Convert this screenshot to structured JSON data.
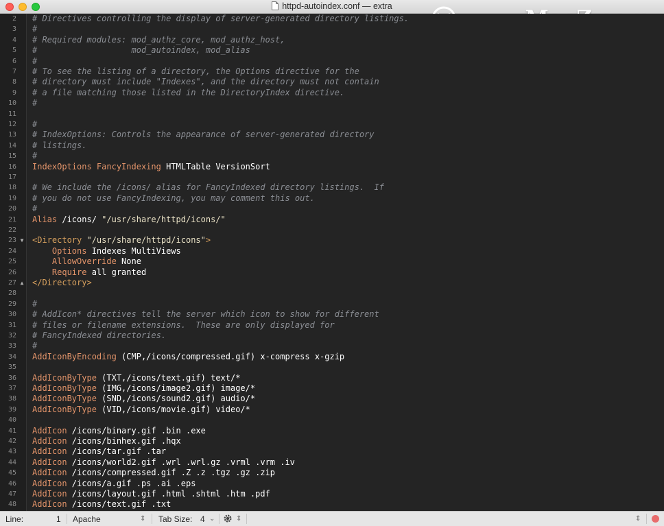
{
  "window": {
    "title": "httpd-autoindex.conf — extra"
  },
  "watermark": {
    "text": "www.MacZ.com"
  },
  "colors": {
    "comment": "#8a8d93",
    "keyword": "#e3946a",
    "text": "#ffffff",
    "string": "#e9e1c5",
    "tag": "#d8a15e",
    "background": "#242424"
  },
  "lines": [
    {
      "n": "2",
      "segs": [
        {
          "t": "# Directives controlling the display of server-generated directory listings.",
          "c": "cm"
        }
      ]
    },
    {
      "n": "3",
      "segs": [
        {
          "t": "#",
          "c": "cm"
        }
      ]
    },
    {
      "n": "4",
      "segs": [
        {
          "t": "# Required modules: mod_authz_core, mod_authz_host,",
          "c": "cm"
        }
      ]
    },
    {
      "n": "5",
      "segs": [
        {
          "t": "#                   mod_autoindex, mod_alias",
          "c": "cm"
        }
      ]
    },
    {
      "n": "6",
      "segs": [
        {
          "t": "#",
          "c": "cm"
        }
      ]
    },
    {
      "n": "7",
      "segs": [
        {
          "t": "# To see the listing of a directory, the Options directive for the",
          "c": "cm"
        }
      ]
    },
    {
      "n": "8",
      "segs": [
        {
          "t": "# directory must include \"Indexes\", and the directory must not contain",
          "c": "cm"
        }
      ]
    },
    {
      "n": "9",
      "segs": [
        {
          "t": "# a file matching those listed in the DirectoryIndex directive.",
          "c": "cm"
        }
      ]
    },
    {
      "n": "10",
      "segs": [
        {
          "t": "#",
          "c": "cm"
        }
      ]
    },
    {
      "n": "11",
      "segs": []
    },
    {
      "n": "12",
      "segs": [
        {
          "t": "#",
          "c": "cm"
        }
      ]
    },
    {
      "n": "13",
      "segs": [
        {
          "t": "# IndexOptions: Controls the appearance of server-generated directory",
          "c": "cm"
        }
      ]
    },
    {
      "n": "14",
      "segs": [
        {
          "t": "# listings.",
          "c": "cm"
        }
      ]
    },
    {
      "n": "15",
      "segs": [
        {
          "t": "#",
          "c": "cm"
        }
      ]
    },
    {
      "n": "16",
      "segs": [
        {
          "t": "IndexOptions FancyIndexing",
          "c": "kw"
        },
        {
          "t": " HTMLTable VersionSort",
          "c": "tx"
        }
      ]
    },
    {
      "n": "17",
      "segs": []
    },
    {
      "n": "18",
      "segs": [
        {
          "t": "# We include the /icons/ alias for FancyIndexed directory listings.  If",
          "c": "cm"
        }
      ]
    },
    {
      "n": "19",
      "segs": [
        {
          "t": "# you do not use FancyIndexing, you may comment this out.",
          "c": "cm"
        }
      ]
    },
    {
      "n": "20",
      "segs": [
        {
          "t": "#",
          "c": "cm"
        }
      ]
    },
    {
      "n": "21",
      "segs": [
        {
          "t": "Alias",
          "c": "kw"
        },
        {
          "t": " /icons/ ",
          "c": "tx"
        },
        {
          "t": "\"/usr/share/httpd/icons/\"",
          "c": "st"
        }
      ]
    },
    {
      "n": "22",
      "segs": []
    },
    {
      "n": "23",
      "fold": "▼",
      "segs": [
        {
          "t": "<Directory ",
          "c": "tg"
        },
        {
          "t": "\"/usr/share/httpd/icons\"",
          "c": "st"
        },
        {
          "t": ">",
          "c": "tg"
        }
      ]
    },
    {
      "n": "24",
      "segs": [
        {
          "t": "    ",
          "c": "tx"
        },
        {
          "t": "Options",
          "c": "kw"
        },
        {
          "t": " Indexes MultiViews",
          "c": "tx"
        }
      ]
    },
    {
      "n": "25",
      "segs": [
        {
          "t": "    ",
          "c": "tx"
        },
        {
          "t": "AllowOverride",
          "c": "kw"
        },
        {
          "t": " None",
          "c": "tx"
        }
      ]
    },
    {
      "n": "26",
      "segs": [
        {
          "t": "    ",
          "c": "tx"
        },
        {
          "t": "Require",
          "c": "kw"
        },
        {
          "t": " all granted",
          "c": "tx"
        }
      ]
    },
    {
      "n": "27",
      "fold": "▲",
      "segs": [
        {
          "t": "</Directory>",
          "c": "tg"
        }
      ]
    },
    {
      "n": "28",
      "segs": []
    },
    {
      "n": "29",
      "segs": [
        {
          "t": "#",
          "c": "cm"
        }
      ]
    },
    {
      "n": "30",
      "segs": [
        {
          "t": "# AddIcon* directives tell the server which icon to show for different",
          "c": "cm"
        }
      ]
    },
    {
      "n": "31",
      "segs": [
        {
          "t": "# files or filename extensions.  These are only displayed for",
          "c": "cm"
        }
      ]
    },
    {
      "n": "32",
      "segs": [
        {
          "t": "# FancyIndexed directories.",
          "c": "cm"
        }
      ]
    },
    {
      "n": "33",
      "segs": [
        {
          "t": "#",
          "c": "cm"
        }
      ]
    },
    {
      "n": "34",
      "segs": [
        {
          "t": "AddIconByEncoding",
          "c": "kw"
        },
        {
          "t": " (CMP,/icons/compressed.gif) x-compress x-gzip",
          "c": "tx"
        }
      ]
    },
    {
      "n": "35",
      "segs": []
    },
    {
      "n": "36",
      "segs": [
        {
          "t": "AddIconByType",
          "c": "kw"
        },
        {
          "t": " (TXT,/icons/text.gif) text/*",
          "c": "tx"
        }
      ]
    },
    {
      "n": "37",
      "segs": [
        {
          "t": "AddIconByType",
          "c": "kw"
        },
        {
          "t": " (IMG,/icons/image2.gif) image/*",
          "c": "tx"
        }
      ]
    },
    {
      "n": "38",
      "segs": [
        {
          "t": "AddIconByType",
          "c": "kw"
        },
        {
          "t": " (SND,/icons/sound2.gif) audio/*",
          "c": "tx"
        }
      ]
    },
    {
      "n": "39",
      "segs": [
        {
          "t": "AddIconByType",
          "c": "kw"
        },
        {
          "t": " (VID,/icons/movie.gif) video/*",
          "c": "tx"
        }
      ]
    },
    {
      "n": "40",
      "segs": []
    },
    {
      "n": "41",
      "segs": [
        {
          "t": "AddIcon",
          "c": "kw"
        },
        {
          "t": " /icons/binary.gif .bin .exe",
          "c": "tx"
        }
      ]
    },
    {
      "n": "42",
      "segs": [
        {
          "t": "AddIcon",
          "c": "kw"
        },
        {
          "t": " /icons/binhex.gif .hqx",
          "c": "tx"
        }
      ]
    },
    {
      "n": "43",
      "segs": [
        {
          "t": "AddIcon",
          "c": "kw"
        },
        {
          "t": " /icons/tar.gif .tar",
          "c": "tx"
        }
      ]
    },
    {
      "n": "44",
      "segs": [
        {
          "t": "AddIcon",
          "c": "kw"
        },
        {
          "t": " /icons/world2.gif .wrl .wrl.gz .vrml .vrm .iv",
          "c": "tx"
        }
      ]
    },
    {
      "n": "45",
      "segs": [
        {
          "t": "AddIcon",
          "c": "kw"
        },
        {
          "t": " /icons/compressed.gif .Z .z .tgz .gz .zip",
          "c": "tx"
        }
      ]
    },
    {
      "n": "46",
      "segs": [
        {
          "t": "AddIcon",
          "c": "kw"
        },
        {
          "t": " /icons/a.gif .ps .ai .eps",
          "c": "tx"
        }
      ]
    },
    {
      "n": "47",
      "segs": [
        {
          "t": "AddIcon",
          "c": "kw"
        },
        {
          "t": " /icons/layout.gif .html .shtml .htm .pdf",
          "c": "tx"
        }
      ]
    },
    {
      "n": "48",
      "segs": [
        {
          "t": "AddIcon",
          "c": "kw"
        },
        {
          "t": " /icons/text.gif .txt",
          "c": "tx"
        }
      ]
    }
  ],
  "status": {
    "line_label": "Line:",
    "line_value": "1",
    "language": "Apache",
    "tab_label": "Tab Size:",
    "tab_value": "4"
  }
}
